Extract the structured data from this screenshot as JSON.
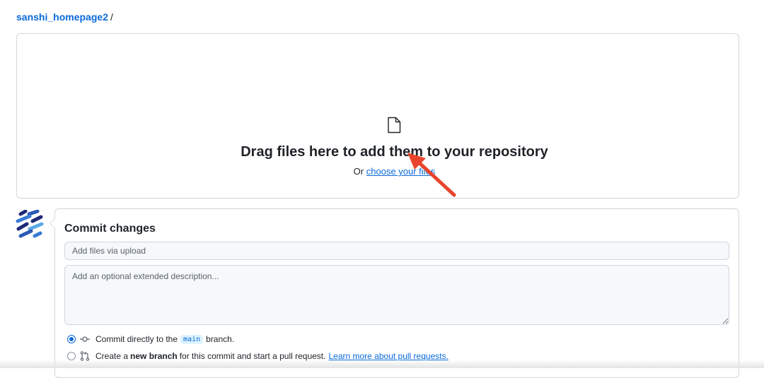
{
  "breadcrumb": {
    "repo": "sanshi_homepage2",
    "separator": "/"
  },
  "dropzone": {
    "icon": "file-icon",
    "title": "Drag files here to add them to your repository",
    "sub_prefix": "Or",
    "choose_link": "choose your files"
  },
  "annotation": {
    "arrow_color": "#e8452c"
  },
  "commit": {
    "title": "Commit changes",
    "summary_placeholder": "Add files via upload",
    "description_placeholder": "Add an optional extended description...",
    "option_direct": {
      "prefix": "Commit directly to the",
      "branch": "main",
      "suffix": "branch.",
      "selected": true
    },
    "option_new_branch": {
      "prefix": "Create a",
      "bold": "new branch",
      "suffix": "for this commit and start a pull request.",
      "link": "Learn more about pull requests.",
      "selected": false
    }
  },
  "colors": {
    "accent": "#0969da",
    "border": "#d0d7de",
    "input_bg": "#f6f8fa"
  }
}
